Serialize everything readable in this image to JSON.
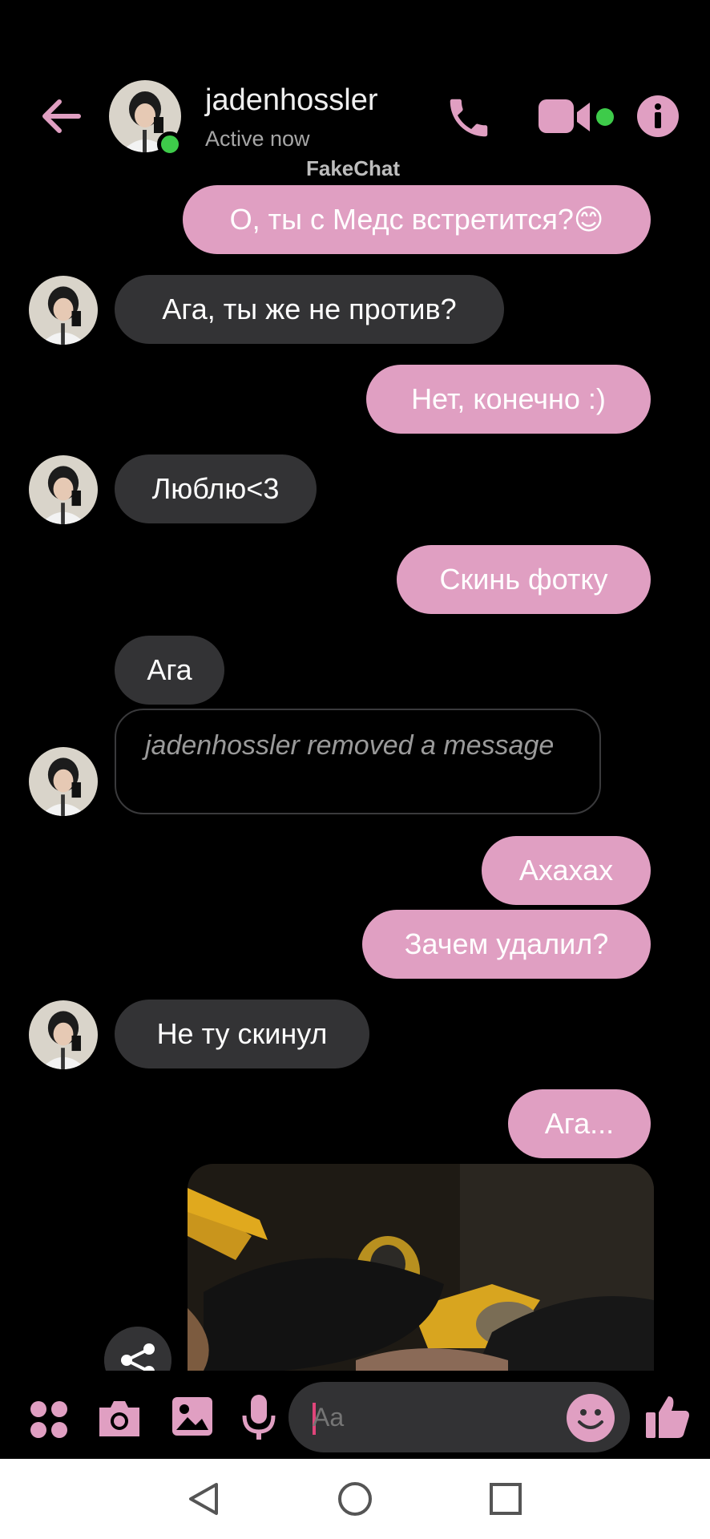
{
  "header": {
    "contact_name": "jadenhossler",
    "status": "Active now",
    "watermark": "FakeChat"
  },
  "messages": [
    {
      "dir": "out",
      "text": "О, ты с Медс встретится?😊"
    },
    {
      "dir": "in",
      "text": "Ага, ты же не против?"
    },
    {
      "dir": "out",
      "text": "Нет, конечно :)"
    },
    {
      "dir": "in",
      "text": "Люблю<3"
    },
    {
      "dir": "out",
      "text": "Скинь фотку"
    },
    {
      "dir": "in",
      "text": "Ага"
    },
    {
      "dir": "in",
      "text": "jadenhossler  removed a message",
      "removed": true
    },
    {
      "dir": "out",
      "text": "Ахахах"
    },
    {
      "dir": "out",
      "text": "Зачем удалил?"
    },
    {
      "dir": "in",
      "text": "Не ту скинул"
    },
    {
      "dir": "out",
      "text": "Ага..."
    }
  ],
  "composer": {
    "placeholder": "Aa"
  },
  "icons": {
    "back": "back-arrow-icon",
    "call": "phone-icon",
    "video": "video-camera-icon",
    "info": "info-icon",
    "apps": "four-dots-icon",
    "camera": "camera-icon",
    "gallery": "image-icon",
    "mic": "microphone-icon",
    "emoji": "smiley-icon",
    "like": "thumbs-up-icon",
    "share": "share-icon"
  },
  "colors": {
    "accent": "#e09fc2",
    "incoming_bubble": "#333335",
    "online": "#3ecb4a",
    "background": "#000000"
  }
}
